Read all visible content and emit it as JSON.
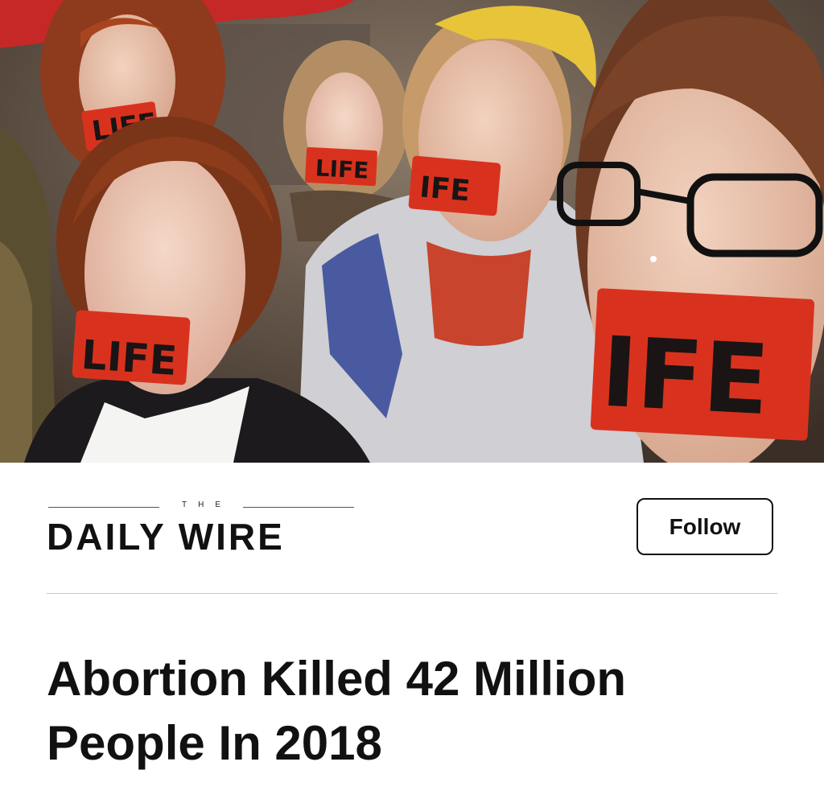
{
  "article": {
    "image": {
      "tape_labels": [
        "LIFE",
        "LIFE",
        "LIFE",
        "IFE",
        "IFE"
      ],
      "colors": {
        "tape": "#d8321f",
        "umbrella": "#c62828",
        "headband": "#e8c43a",
        "jacket": "#cfcfd4",
        "jacket_trim": "#4a5aa0",
        "shirt": "#c8442c"
      }
    },
    "publisher": {
      "the": "THE",
      "name": "DAILY WIRE"
    },
    "follow_label": "Follow",
    "headline": "Abortion Killed 42 Million People In 2018"
  }
}
